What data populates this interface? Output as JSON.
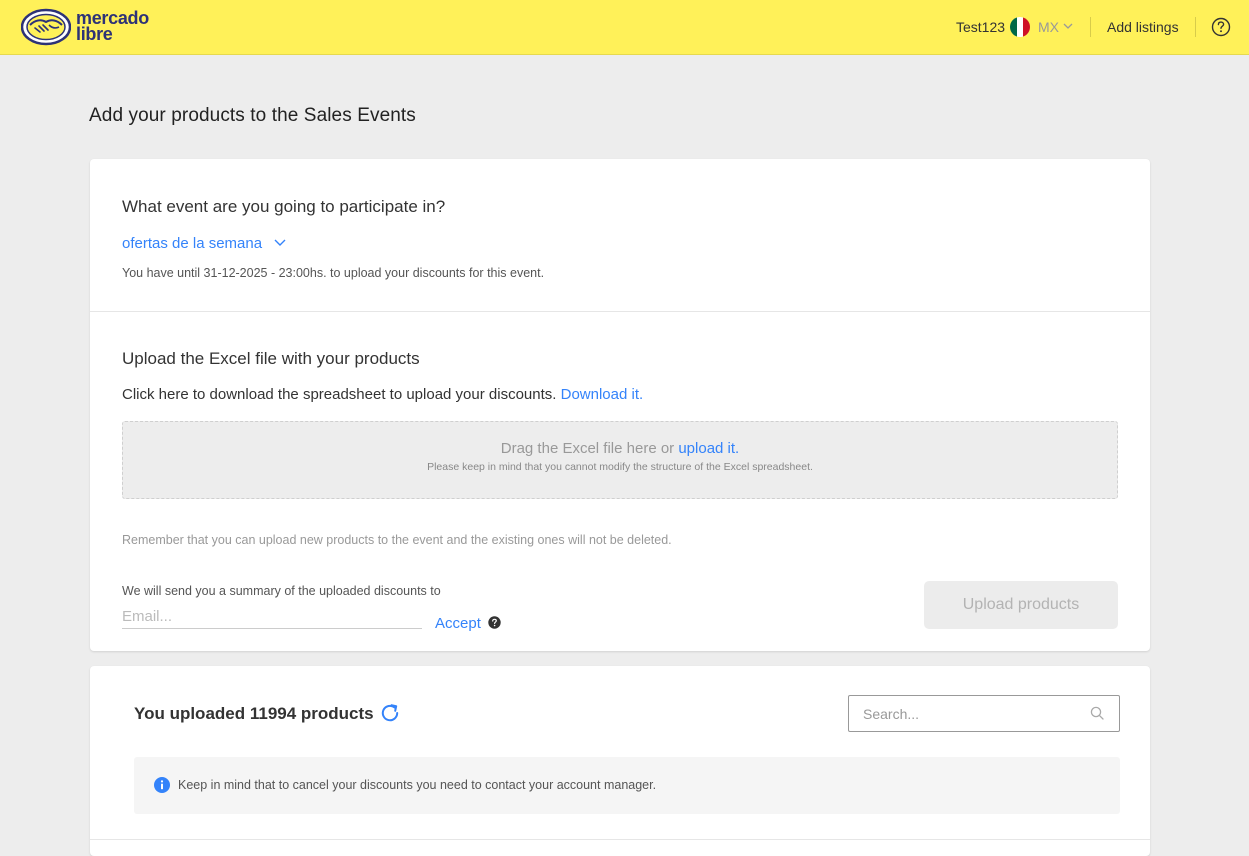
{
  "header": {
    "logo_line1": "mercado",
    "logo_line2": "libre",
    "user": "Test123",
    "country": "MX",
    "add_listings": "Add listings"
  },
  "page": {
    "title": "Add your products to the Sales Events"
  },
  "event_section": {
    "question": "What event are you going to participate in?",
    "selected_event": "ofertas de la semana",
    "deadline": "You have until 31-12-2025 - 23:00hs. to upload your discounts for this event."
  },
  "upload_section": {
    "title": "Upload the Excel file with your products",
    "download_prompt": "Click here to download the spreadsheet to upload your discounts.",
    "download_link": "Download it.",
    "dropzone_text": "Drag the Excel file here or",
    "dropzone_link": "upload it.",
    "dropzone_note": "Please keep in mind that you cannot modify the structure of the Excel spreadsheet.",
    "remember_note": "Remember that you can upload new products to the event and the existing ones will not be deleted.",
    "summary_label": "We will send you a summary of the uploaded discounts to",
    "email_value": "",
    "email_placeholder": "Email...",
    "accept_label": "Accept",
    "upload_button": "Upload products"
  },
  "products_section": {
    "title": "You uploaded 11994 products",
    "search_value": "",
    "search_placeholder": "Search...",
    "info_text": "Keep in mind that to cancel your discounts you need to contact your account manager."
  },
  "colors": {
    "header_bg": "#fff159",
    "brand_navy": "#2d3277",
    "link_blue": "#3483fa",
    "page_bg": "#ededed"
  },
  "icons": {
    "logo": "handshake-logo-icon",
    "flag": "mexico-flag-icon",
    "help": "question-circle-icon",
    "refresh": "refresh-icon",
    "search": "search-icon",
    "info": "info-circle-icon"
  }
}
